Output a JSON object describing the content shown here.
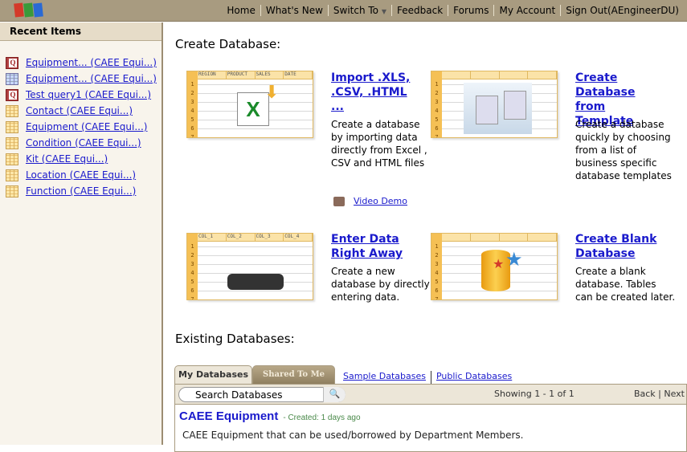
{
  "topbar": {
    "logo": "ZOI",
    "nav": [
      "Home",
      "What's New",
      "Switch To",
      "Feedback",
      "Forums",
      "My Account",
      "Sign Out(AEngineerDU)"
    ]
  },
  "sidebar": {
    "title": "Recent Items",
    "items": [
      {
        "label": "Equipment... (CAEE Equi...)",
        "icon": "query-icon"
      },
      {
        "label": "Equipment... (CAEE Equi...)",
        "icon": "view-icon"
      },
      {
        "label": "Test query1 (CAEE Equi...)",
        "icon": "query-icon"
      },
      {
        "label": "Contact (CAEE Equi...)",
        "icon": "table-icon"
      },
      {
        "label": "Equipment (CAEE Equi...)",
        "icon": "table-icon"
      },
      {
        "label": "Condition (CAEE Equi...)",
        "icon": "table-icon"
      },
      {
        "label": "Kit (CAEE Equi...)",
        "icon": "table-icon"
      },
      {
        "label": "Location (CAEE Equi...)",
        "icon": "table-icon"
      },
      {
        "label": "Function (CAEE Equi...)",
        "icon": "table-icon"
      }
    ]
  },
  "create": {
    "title": "Create Database:",
    "import": {
      "title": "Import .XLS, .CSV, .HTML ...",
      "desc": "Create a database by importing data directly from Excel , CSV and HTML files",
      "video": "Video Demo",
      "cols": [
        "REGION",
        "PRODUCT",
        "SALES",
        "DATE"
      ]
    },
    "template": {
      "title": "Create Database from Template",
      "desc": "Create a database quickly by choosing from a list of business specific database templates"
    },
    "enter": {
      "title": "Enter Data Right Away",
      "desc": "Create a new database by directly entering data.",
      "cols": [
        "COL_1",
        "COL_2",
        "COL_3",
        "COL_4"
      ]
    },
    "blank": {
      "title": "Create Blank Database",
      "desc": "Create a blank database. Tables can be created later."
    }
  },
  "existing": {
    "title": "Existing Databases:",
    "tabs": [
      "My Databases",
      "Shared To Me"
    ],
    "links": [
      "Sample Databases",
      "Public Databases"
    ],
    "search_placeholder": "Search Databases",
    "showing": "Showing 1 - 1 of 1",
    "back": "Back",
    "next": "Next",
    "databases": [
      {
        "name": "CAEE Equipment",
        "created": "- Created: 1 days ago",
        "desc": "CAEE Equipment that can be used/borrowed by Department Members."
      }
    ]
  }
}
